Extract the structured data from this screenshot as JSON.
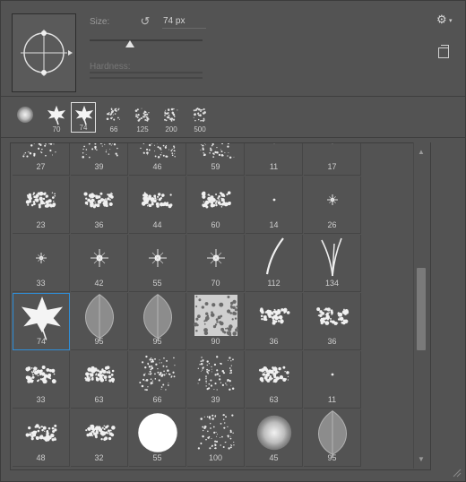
{
  "controls": {
    "size_label": "Size:",
    "size_value": "74 px",
    "size_fraction": 0.36,
    "hardness_label": "Hardness:",
    "reset_icon": "reset-icon",
    "gear_icon": "gear-icon",
    "new_preset_icon": "new-preset-icon"
  },
  "recent_brushes": [
    {
      "label": "",
      "shape": "soft-round"
    },
    {
      "label": "70",
      "shape": "leaf"
    },
    {
      "label": "74",
      "shape": "leaf",
      "selected": true
    },
    {
      "label": "66",
      "shape": "splatter"
    },
    {
      "label": "125",
      "shape": "splatter"
    },
    {
      "label": "200",
      "shape": "splatter"
    },
    {
      "label": "500",
      "shape": "splatter"
    }
  ],
  "grid": {
    "rows": [
      [
        {
          "label": "27",
          "shape": "scatter"
        },
        {
          "label": "39",
          "shape": "scatter"
        },
        {
          "label": "46",
          "shape": "scatter"
        },
        {
          "label": "59",
          "shape": "scatter"
        },
        {
          "label": "11",
          "shape": "dot"
        },
        {
          "label": "17",
          "shape": "dot"
        }
      ],
      [
        {
          "label": "23",
          "shape": "chalk"
        },
        {
          "label": "36",
          "shape": "chalk"
        },
        {
          "label": "44",
          "shape": "chalk"
        },
        {
          "label": "60",
          "shape": "chalk"
        },
        {
          "label": "14",
          "shape": "tiny"
        },
        {
          "label": "26",
          "shape": "star-small"
        }
      ],
      [
        {
          "label": "33",
          "shape": "star-small"
        },
        {
          "label": "42",
          "shape": "star"
        },
        {
          "label": "55",
          "shape": "star"
        },
        {
          "label": "70",
          "shape": "star"
        },
        {
          "label": "112",
          "shape": "grass1"
        },
        {
          "label": "134",
          "shape": "grass2"
        }
      ],
      [
        {
          "label": "74",
          "shape": "leaf",
          "selected": true
        },
        {
          "label": "95",
          "shape": "leaf-gray"
        },
        {
          "label": "95",
          "shape": "leaf-gray"
        },
        {
          "label": "90",
          "shape": "texture"
        },
        {
          "label": "36",
          "shape": "chalk"
        },
        {
          "label": "36",
          "shape": "chalk"
        }
      ],
      [
        {
          "label": "33",
          "shape": "chalk"
        },
        {
          "label": "63",
          "shape": "chalk"
        },
        {
          "label": "66",
          "shape": "scatter"
        },
        {
          "label": "39",
          "shape": "scatter"
        },
        {
          "label": "63",
          "shape": "chalk"
        },
        {
          "label": "11",
          "shape": "tiny"
        }
      ],
      [
        {
          "label": "48",
          "shape": "chalk"
        },
        {
          "label": "32",
          "shape": "chalk"
        },
        {
          "label": "55",
          "shape": "hard-round"
        },
        {
          "label": "100",
          "shape": "scatter"
        },
        {
          "label": "45",
          "shape": "soft-round"
        },
        {
          "label": "95",
          "shape": "leaf-gray"
        }
      ]
    ]
  }
}
